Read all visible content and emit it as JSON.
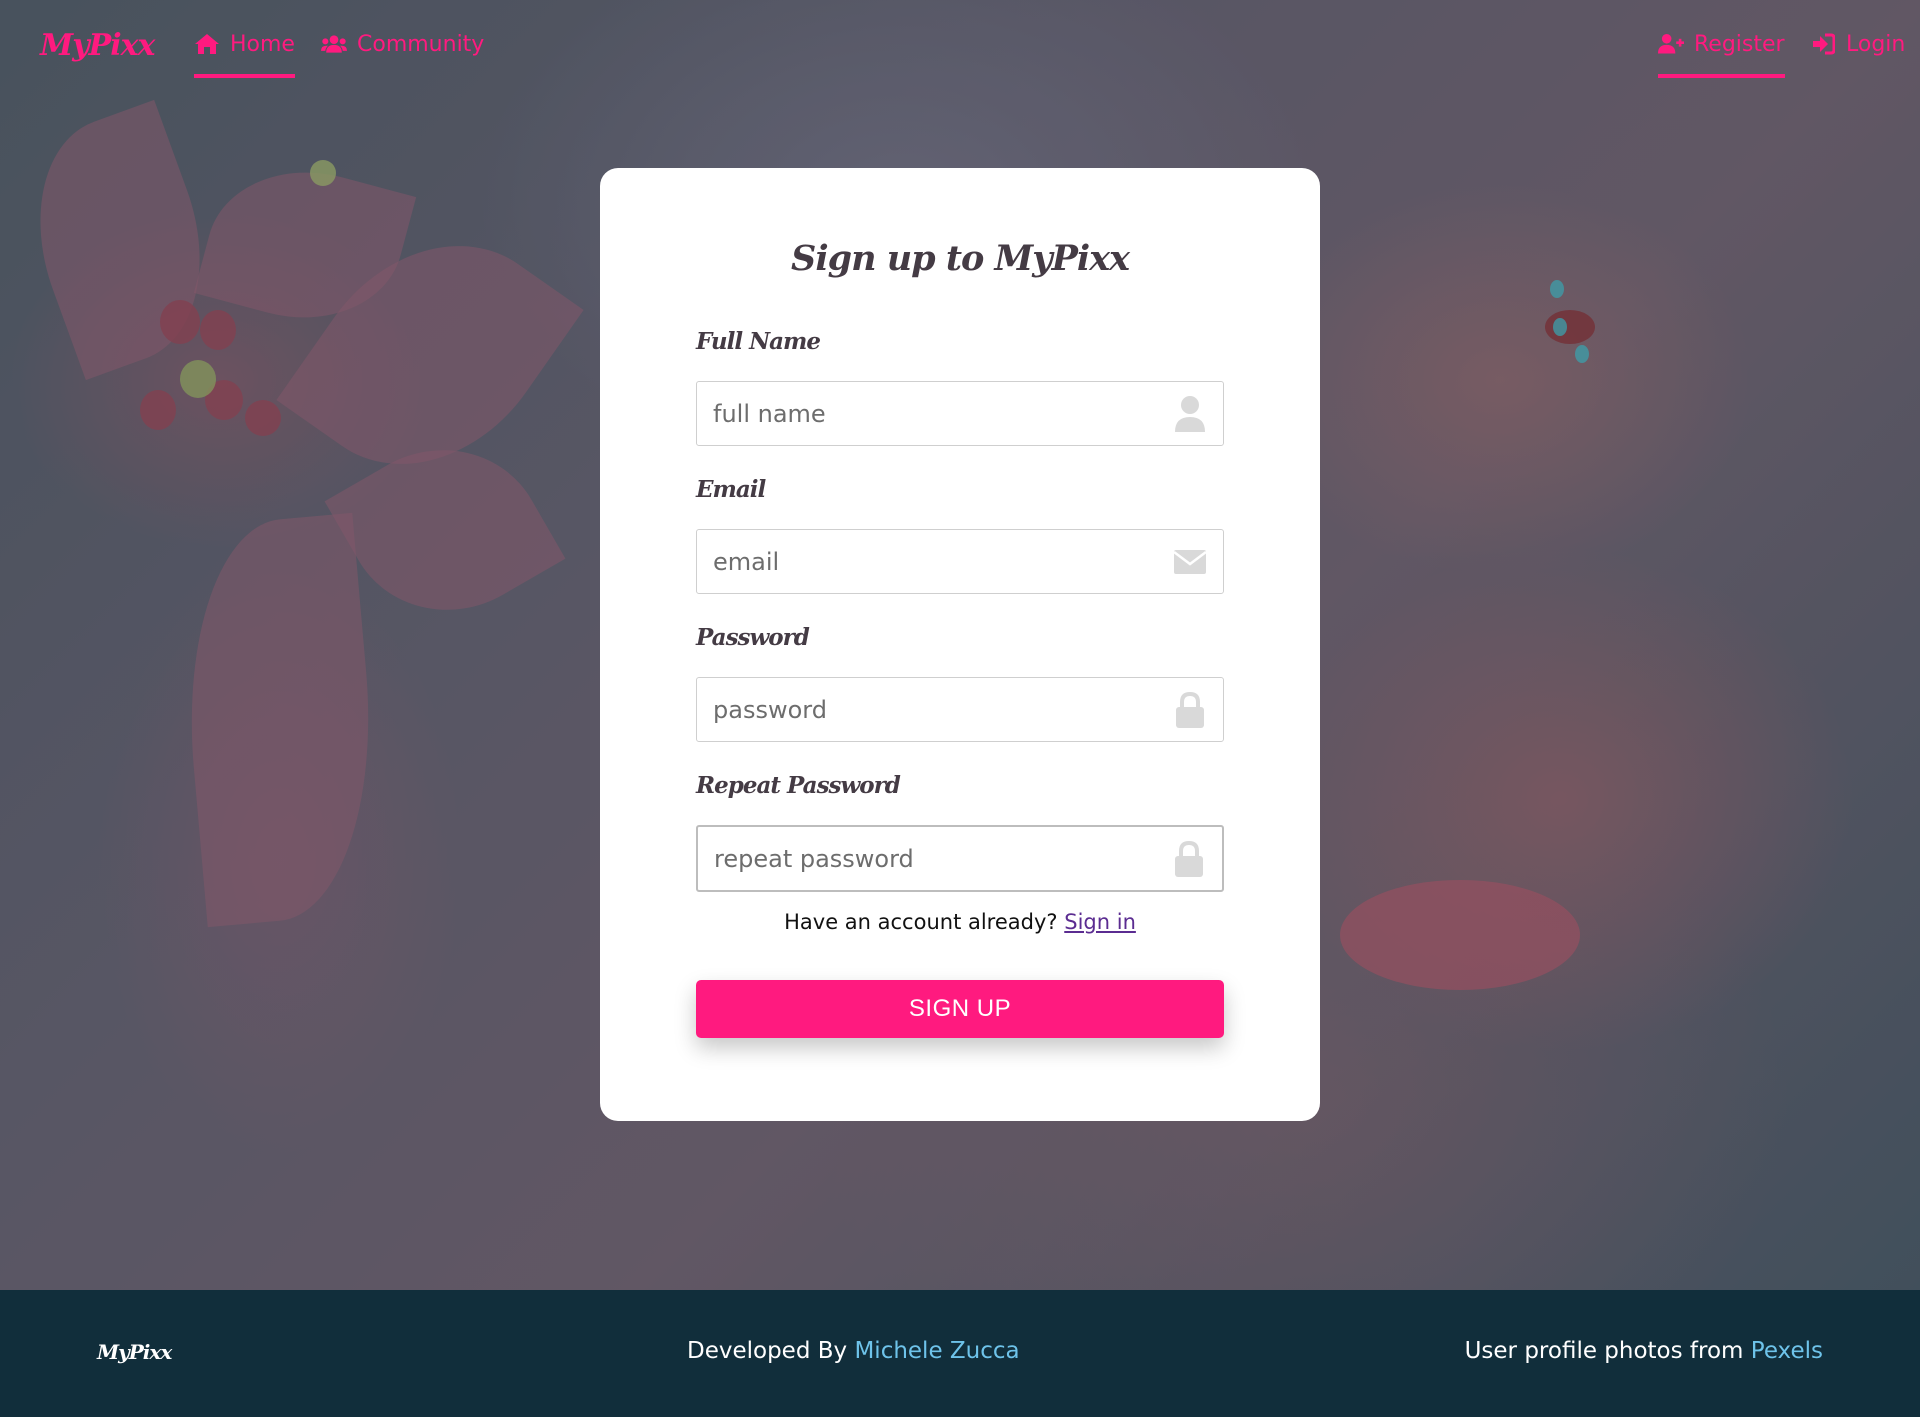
{
  "nav": {
    "brand": "MyPixx",
    "home_label": "Home",
    "community_label": "Community",
    "register_label": "Register",
    "login_label": "Login"
  },
  "form": {
    "title": "Sign up to MyPixx",
    "full_name": {
      "label": "Full Name",
      "placeholder": "full name"
    },
    "email": {
      "label": "Email",
      "placeholder": "email"
    },
    "password": {
      "label": "Password",
      "placeholder": "password"
    },
    "repeat_password": {
      "label": "Repeat Password",
      "placeholder": "repeat password"
    },
    "have_account_text": "Have an account already?",
    "sign_in_link": "Sign in",
    "submit_label": "SIGN UP"
  },
  "footer": {
    "brand": "MyPixx",
    "developed_by_text": "Developed By",
    "developer_name": "Michele Zucca",
    "photos_text": "User profile photos from",
    "photos_source": "Pexels"
  },
  "colors": {
    "accent": "#ff1a7f",
    "footer_bg": "#112e3b",
    "link": "#6ec3ea",
    "heading": "#443b44"
  },
  "icons": {
    "home": "home-icon",
    "community": "users-icon",
    "register": "user-plus-icon",
    "login": "sign-in-icon",
    "full_name": "user-icon",
    "email": "envelope-icon",
    "password": "lock-icon",
    "repeat_password": "lock-icon"
  }
}
